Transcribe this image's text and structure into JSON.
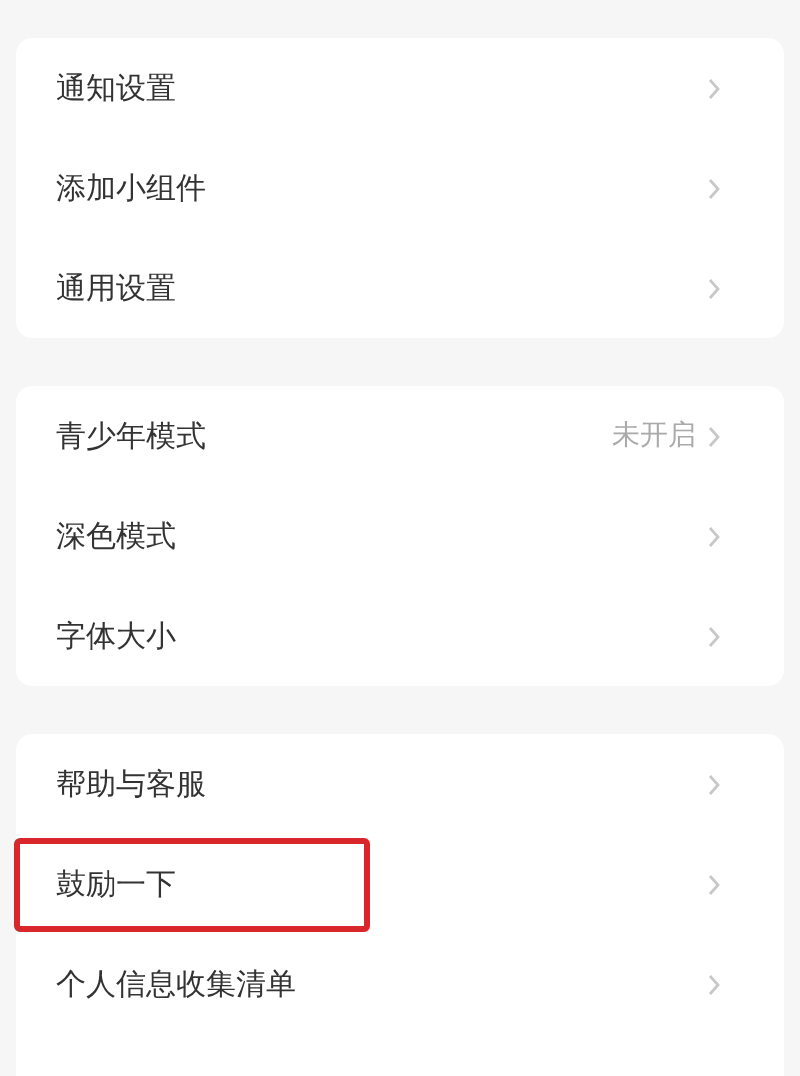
{
  "groups": [
    {
      "items": [
        {
          "label": "通知设置",
          "highlighted": false
        },
        {
          "label": "添加小组件",
          "highlighted": false
        },
        {
          "label": "通用设置",
          "highlighted": false
        }
      ]
    },
    {
      "items": [
        {
          "label": "青少年模式",
          "value": "未开启",
          "highlighted": false
        },
        {
          "label": "深色模式",
          "highlighted": false
        },
        {
          "label": "字体大小",
          "highlighted": false
        }
      ]
    },
    {
      "items": [
        {
          "label": "帮助与客服",
          "highlighted": false
        },
        {
          "label": "鼓励一下",
          "highlighted": true
        },
        {
          "label": "个人信息收集清单",
          "highlighted": false
        }
      ]
    }
  ]
}
